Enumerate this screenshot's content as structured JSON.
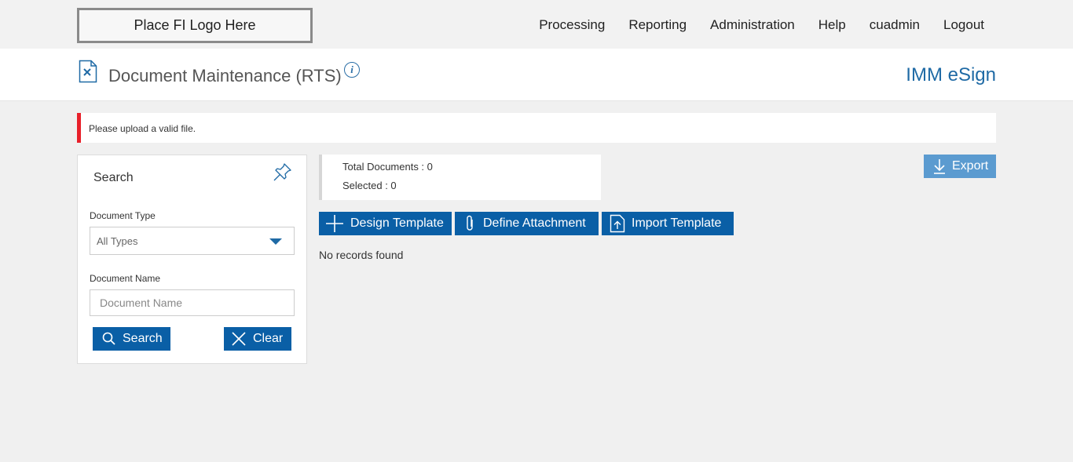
{
  "header": {
    "logo_text": "Place FI Logo Here",
    "nav": [
      "Processing",
      "Reporting",
      "Administration",
      "Help",
      "cuadmin",
      "Logout"
    ]
  },
  "title_bar": {
    "title": "Document Maintenance (RTS)",
    "brand": "IMM eSign",
    "info_icon": "i"
  },
  "alert": {
    "message": "Please upload a valid file.",
    "color": "#e8202a"
  },
  "search_panel": {
    "title": "Search",
    "document_type_label": "Document Type",
    "document_type_value": "All Types",
    "document_name_label": "Document Name",
    "document_name_placeholder": "Document Name",
    "search_button": "Search",
    "clear_button": "Clear"
  },
  "stats": {
    "total_label": "Total Documents : 0",
    "selected_label": "Selected : 0"
  },
  "actions": {
    "design_template": "Design Template",
    "define_attachment": "Define Attachment",
    "import_template": "Import Template",
    "export": "Export"
  },
  "results": {
    "empty_message": "No records found"
  },
  "colors": {
    "primary": "#0a5fa6",
    "export": "#5b9bd0",
    "brand": "#1f6aa5"
  }
}
